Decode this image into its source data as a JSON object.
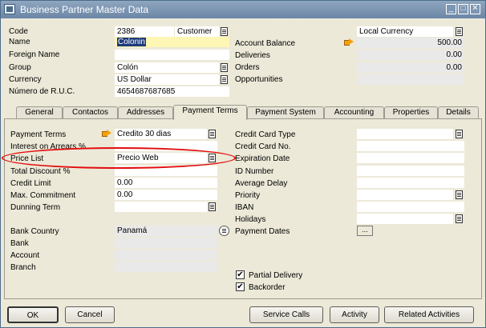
{
  "window": {
    "title": "Business Partner Master Data"
  },
  "header_left": {
    "code": {
      "label": "Code",
      "value": "2386",
      "type": "Customer"
    },
    "name": {
      "label": "Name",
      "value": "Colonin"
    },
    "foreign_name": {
      "label": "Foreign Name",
      "value": ""
    },
    "group": {
      "label": "Group",
      "value": "Colón"
    },
    "currency": {
      "label": "Currency",
      "value": "US Dollar"
    },
    "ruc": {
      "label": "Número de R.U.C.",
      "value": "4654687687685"
    }
  },
  "header_right": {
    "currency_mode": "Local Currency",
    "account_balance": {
      "label": "Account Balance",
      "value": "500.00"
    },
    "deliveries": {
      "label": "Deliveries",
      "value": "0.00"
    },
    "orders": {
      "label": "Orders",
      "value": "0.00"
    },
    "opportunities": {
      "label": "Opportunities",
      "value": ""
    }
  },
  "tabs": [
    {
      "label": "General"
    },
    {
      "label": "Contactos"
    },
    {
      "label": "Addresses"
    },
    {
      "label": "Payment Terms",
      "active": true
    },
    {
      "label": "Payment System"
    },
    {
      "label": "Accounting"
    },
    {
      "label": "Properties"
    },
    {
      "label": "Details"
    }
  ],
  "payment_left": {
    "payment_terms": {
      "label": "Payment Terms",
      "value": "Credito 30 dias"
    },
    "interest": {
      "label": "Interest on Arrears %",
      "value": ""
    },
    "price_list": {
      "label": "Price List",
      "value": "Precio Web"
    },
    "total_discount": {
      "label": "Total Discount %",
      "value": ""
    },
    "credit_limit": {
      "label": "Credit Limit",
      "value": "0.00"
    },
    "max_commitment": {
      "label": "Max. Commitment",
      "value": "0.00"
    },
    "dunning_term": {
      "label": "Dunning Term",
      "value": ""
    },
    "bank_country": {
      "label": "Bank Country",
      "value": "Panamá"
    },
    "bank": {
      "label": "Bank",
      "value": ""
    },
    "account": {
      "label": "Account",
      "value": ""
    },
    "branch": {
      "label": "Branch",
      "value": ""
    }
  },
  "payment_right": {
    "credit_card_type": {
      "label": "Credit Card Type",
      "value": ""
    },
    "credit_card_no": {
      "label": "Credit Card  No.",
      "value": ""
    },
    "expiration_date": {
      "label": "Expiration Date",
      "value": ""
    },
    "id_number": {
      "label": "ID Number",
      "value": ""
    },
    "average_delay": {
      "label": "Average Delay",
      "value": ""
    },
    "priority": {
      "label": "Priority",
      "value": ""
    },
    "iban": {
      "label": "IBAN",
      "value": ""
    },
    "holidays": {
      "label": "Holidays",
      "value": ""
    },
    "payment_dates": {
      "label": "Payment Dates",
      "button": "..."
    }
  },
  "checkboxes": {
    "partial_delivery": {
      "label": "Partial Delivery",
      "checked": true,
      "mark": "✔"
    },
    "backorder": {
      "label": "Backorder",
      "checked": true,
      "mark": "✔"
    }
  },
  "buttons": {
    "ok": "OK",
    "cancel": "Cancel",
    "service_calls": "Service Calls",
    "activity": "Activity",
    "related_activities": "Related Activities"
  },
  "colors": {
    "highlight_oval": "#e20e0e",
    "name_field_bg": "#fdf6b4",
    "link_arrow": "#f4a10b"
  },
  "icons": {
    "list": "list-icon",
    "link_arrow": "link-arrow-icon",
    "minimize": "minimize-icon",
    "maximize": "maximize-icon",
    "close": "close-icon"
  },
  "window_controls": {
    "minimize": "_",
    "maximize": "□",
    "close": "✕"
  }
}
